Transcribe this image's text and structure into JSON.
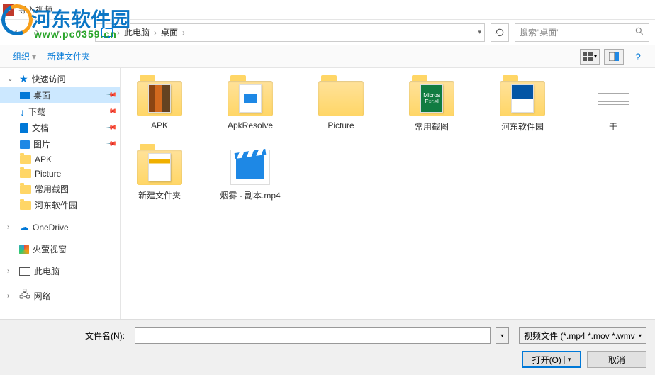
{
  "window": {
    "title": "导入视频"
  },
  "watermark": {
    "name": "河东软件园",
    "url": "www.pc0359.cn"
  },
  "nav": {
    "path": [
      "此电脑",
      "桌面"
    ],
    "search_placeholder": "搜索\"桌面\"",
    "dropdown_hint": "▾"
  },
  "toolbar": {
    "organize": "组织",
    "new_folder": "新建文件夹"
  },
  "sidebar": {
    "quick": {
      "label": "快速访问",
      "expanded": true
    },
    "quick_items": [
      {
        "label": "桌面",
        "icon": "desktop",
        "pinned": true,
        "selected": true
      },
      {
        "label": "下载",
        "icon": "download",
        "pinned": true
      },
      {
        "label": "文档",
        "icon": "doc",
        "pinned": true
      },
      {
        "label": "图片",
        "icon": "pic",
        "pinned": true
      },
      {
        "label": "APK",
        "icon": "folder"
      },
      {
        "label": "Picture",
        "icon": "folder"
      },
      {
        "label": "常用截图",
        "icon": "folder"
      },
      {
        "label": "河东软件园",
        "icon": "folder"
      }
    ],
    "onedrive": "OneDrive",
    "firefox": "火萤视窗",
    "this_pc": "此电脑",
    "network": "网络"
  },
  "items": [
    {
      "label": "APK",
      "type": "folder",
      "thumb": "apk"
    },
    {
      "label": "ApkResolve",
      "type": "folder",
      "thumb": "resolve"
    },
    {
      "label": "Picture",
      "type": "folder",
      "thumb": ""
    },
    {
      "label": "常用截图",
      "type": "folder",
      "thumb": "office"
    },
    {
      "label": "河东软件园",
      "type": "folder",
      "thumb": "web"
    },
    {
      "label": "于",
      "type": "lines"
    },
    {
      "label": "新建文件夹",
      "type": "folder",
      "thumb": "web2"
    },
    {
      "label": "烟雾 - 副本.mp4",
      "type": "video"
    }
  ],
  "footer": {
    "filename_label": "文件名(N):",
    "filename_value": "",
    "filter": "视频文件 (*.mp4 *.mov *.wmv",
    "open": "打开(O)",
    "cancel": "取消"
  }
}
